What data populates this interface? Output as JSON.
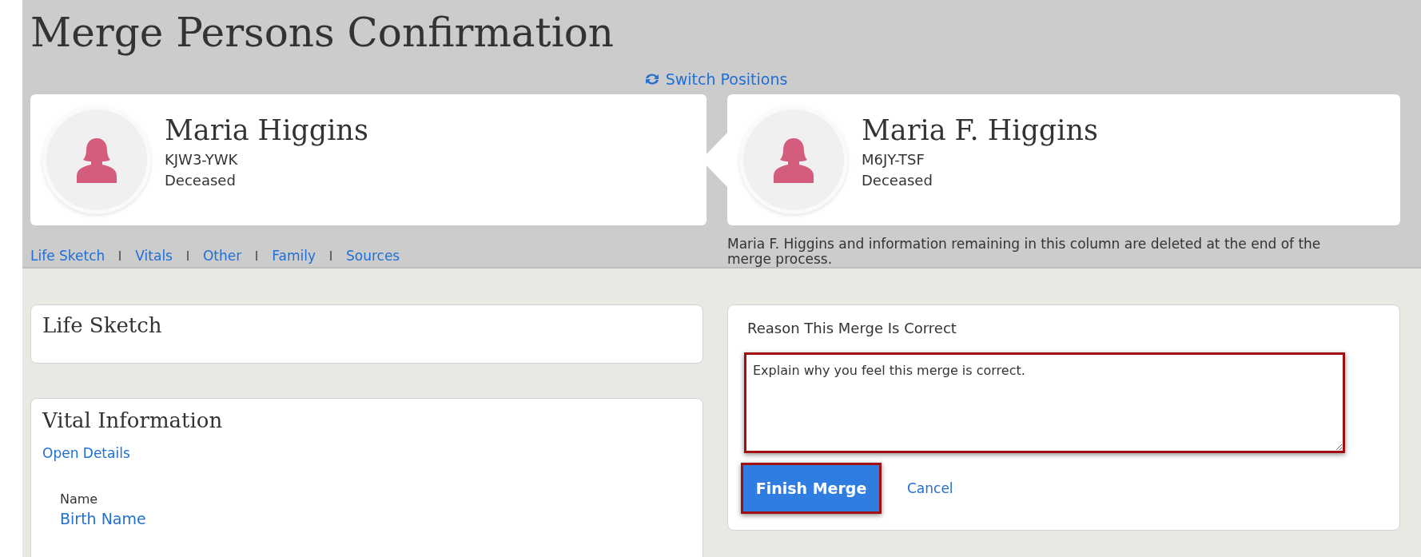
{
  "page_title": "Merge Persons Confirmation",
  "switch_positions": "Switch Positions",
  "persons": [
    {
      "name": "Maria Higgins",
      "id": "KJW3-YWK",
      "status": "Deceased"
    },
    {
      "name": "Maria F. Higgins",
      "id": "M6JY-TSF",
      "status": "Deceased"
    }
  ],
  "section_links": [
    "Life Sketch",
    "Vitals",
    "Other",
    "Family",
    "Sources"
  ],
  "deletion_note": "Maria F. Higgins and information remaining in this column are deleted at the end of the merge process.",
  "life_sketch": {
    "title": "Life Sketch"
  },
  "vital_information": {
    "title": "Vital Information",
    "open_details": "Open Details",
    "field_label": "Name",
    "field_link": "Birth Name"
  },
  "reason": {
    "title": "Reason This Merge Is Correct",
    "placeholder": "Explain why you feel this merge is correct.",
    "finish_button": "Finish Merge",
    "cancel_link": "Cancel"
  }
}
